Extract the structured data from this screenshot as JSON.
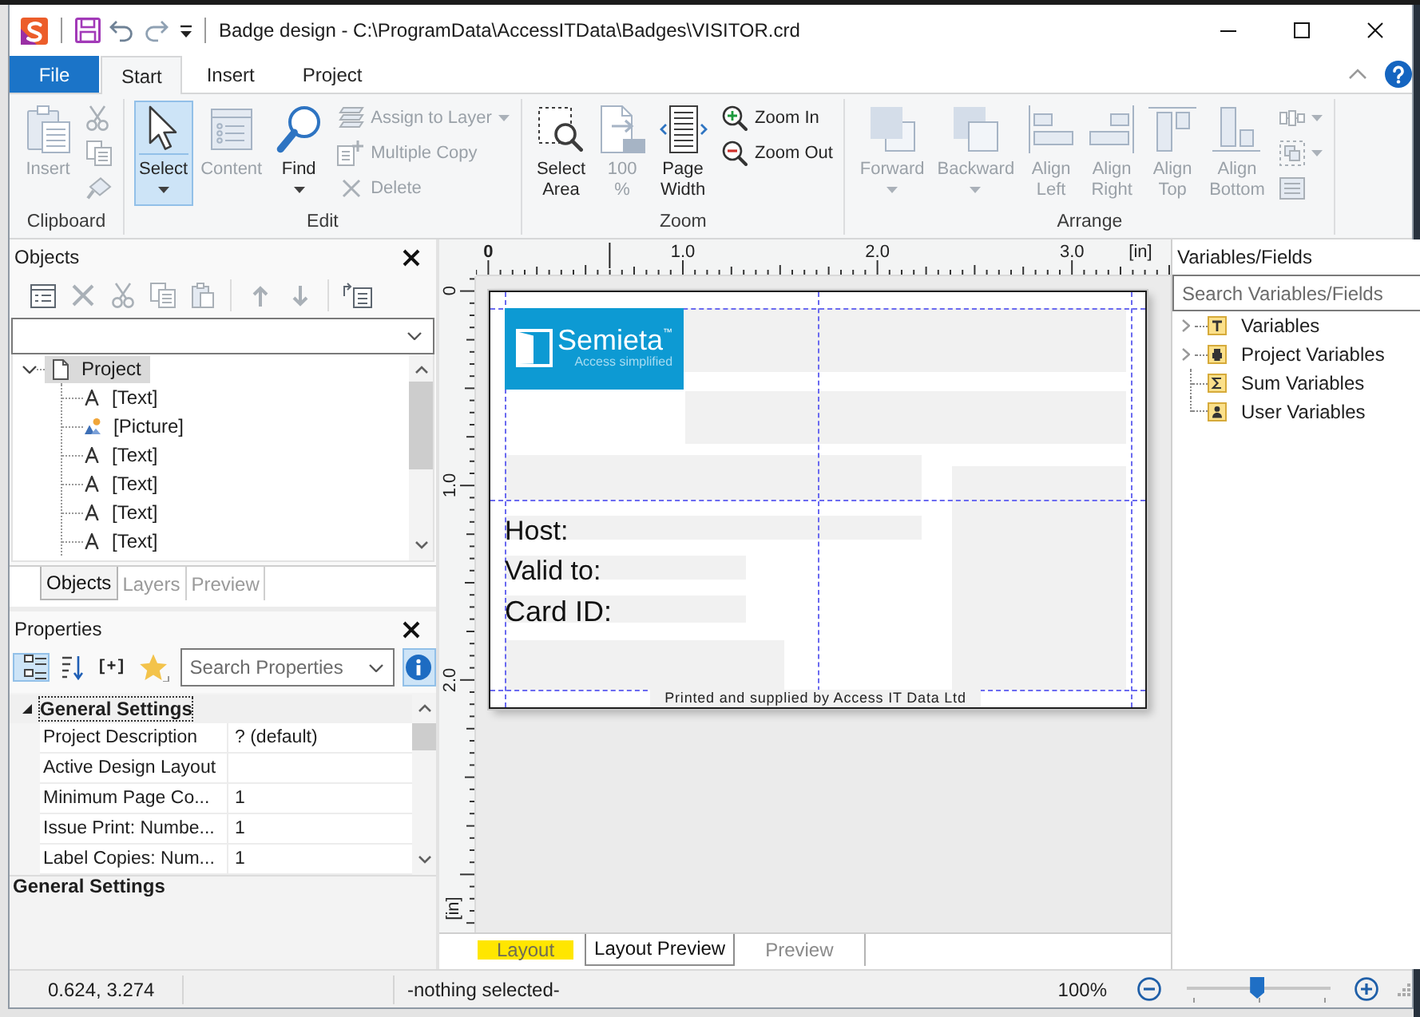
{
  "window": {
    "title": "Badge design - C:\\ProgramData\\AccessITData\\Badges\\VISITOR.crd"
  },
  "ribbon": {
    "tabs": [
      {
        "label": "File",
        "kind": "file",
        "selected": false
      },
      {
        "label": "Start",
        "kind": "tab",
        "selected": true
      },
      {
        "label": "Insert",
        "kind": "tab",
        "selected": false
      },
      {
        "label": "Project",
        "kind": "tab",
        "selected": false
      }
    ],
    "groups": [
      {
        "label": "Clipboard",
        "large": [
          {
            "label": "Insert",
            "disabled": true,
            "pressed": false,
            "dropdown": false
          }
        ],
        "small": [
          {
            "disabled": true,
            "dropdown": false
          },
          {
            "disabled": true,
            "dropdown": false
          },
          {
            "disabled": true,
            "dropdown": false
          }
        ]
      },
      {
        "label": "Edit",
        "large": [
          {
            "label": "Select",
            "disabled": false,
            "pressed": true,
            "dropdown": true
          },
          {
            "label": "Content",
            "disabled": true,
            "pressed": false,
            "dropdown": false
          },
          {
            "label": "Find",
            "disabled": false,
            "pressed": false,
            "dropdown": true
          }
        ],
        "small": [
          {
            "label": "Assign to Layer",
            "disabled": true,
            "dropdown": true
          },
          {
            "label": "Multiple Copy",
            "disabled": true,
            "dropdown": false
          },
          {
            "label": "Delete",
            "disabled": true,
            "dropdown": false
          }
        ]
      },
      {
        "label": "Zoom",
        "large": [
          {
            "label": "Select Area",
            "disabled": false,
            "pressed": false,
            "dropdown": false
          },
          {
            "label": "100 %",
            "disabled": true,
            "pressed": false,
            "dropdown": false
          },
          {
            "label": "Page Width",
            "disabled": false,
            "pressed": false,
            "dropdown": false
          }
        ],
        "small": [
          {
            "label": "Zoom In",
            "disabled": false,
            "dropdown": false
          },
          {
            "label": "Zoom Out",
            "disabled": false,
            "dropdown": false
          }
        ]
      },
      {
        "label": "Arrange",
        "large": [
          {
            "label": "Forward",
            "disabled": true,
            "pressed": false,
            "dropdown": true
          },
          {
            "label": "Backward",
            "disabled": true,
            "pressed": false,
            "dropdown": true
          },
          {
            "label": "Align Left",
            "disabled": true,
            "pressed": false,
            "dropdown": false
          },
          {
            "label": "Align Right",
            "disabled": true,
            "pressed": false,
            "dropdown": false
          },
          {
            "label": "Align Top",
            "disabled": true,
            "pressed": false,
            "dropdown": false
          },
          {
            "label": "Align Bottom",
            "disabled": true,
            "pressed": false,
            "dropdown": false
          }
        ],
        "small": [
          {
            "disabled": true,
            "dropdown": true
          },
          {
            "disabled": true,
            "dropdown": true
          },
          {
            "disabled": true,
            "dropdown": false
          }
        ]
      }
    ]
  },
  "objects_panel": {
    "title": "Objects",
    "tools": [
      {
        "disabled": false
      },
      {
        "disabled": true
      },
      {
        "disabled": true
      },
      {
        "disabled": true
      },
      {
        "disabled": true
      },
      {
        "disabled": true
      },
      {
        "disabled": true
      },
      {
        "disabled": false
      }
    ],
    "tree": {
      "label": "Project",
      "expanded": true,
      "selected": true,
      "children": [
        {
          "label": "[Text]",
          "kind": "text",
          "selected": false
        },
        {
          "label": "[Picture]",
          "kind": "picture",
          "selected": false
        },
        {
          "label": "[Text]",
          "kind": "text",
          "selected": false
        },
        {
          "label": "[Text]",
          "kind": "text",
          "selected": false
        },
        {
          "label": "[Text]",
          "kind": "text",
          "selected": false
        },
        {
          "label": "[Text]",
          "kind": "text",
          "selected": false
        }
      ]
    },
    "tabs": [
      {
        "label": "Objects",
        "selected": true
      },
      {
        "label": "Layers",
        "selected": false
      },
      {
        "label": "Preview",
        "selected": false
      }
    ]
  },
  "properties_panel": {
    "title": "Properties",
    "tools": [
      {
        "kind": "categorized",
        "pressed": true
      },
      {
        "kind": "sort",
        "pressed": false
      },
      {
        "kind": "text",
        "label": "[+]",
        "pressed": false
      },
      {
        "kind": "favorites",
        "pressed": false
      }
    ],
    "search": {
      "placeholder": "Search Properties"
    },
    "info": {
      "pressed": true
    },
    "category": {
      "label": "General Settings",
      "expanded": true
    },
    "rows": [
      {
        "name": "Project Description",
        "value": "? (default)"
      },
      {
        "name": "Active Design Layout"
      },
      {
        "name": "Minimum Page Co...",
        "value": "1"
      },
      {
        "name": "Issue Print: Numbe...",
        "value": "1"
      },
      {
        "name": "Label Copies: Num...",
        "value": "1"
      }
    ],
    "description": "General Settings"
  },
  "canvas": {
    "ruler": {
      "top_labels": [
        "0",
        "1.0",
        "2.0",
        "3.0"
      ],
      "top_unit": "[in]",
      "side_labels": [
        "0",
        "1.0",
        "2.0"
      ],
      "side_unit": "[in]"
    },
    "badge": {
      "logo": {
        "wordmark": "Semieta$^{™}$",
        "tagline": "Access simplified"
      },
      "labels": [
        "Host:",
        "Valid to:",
        "Card ID:"
      ],
      "footer": "Printed and supplied by Access IT Data Ltd"
    },
    "tabs": [
      {
        "label": "Layout",
        "selected": false,
        "highlighted": true
      },
      {
        "label": "Layout Preview",
        "selected": true,
        "highlighted": false
      },
      {
        "label": "Preview",
        "selected": false,
        "highlighted": false
      }
    ]
  },
  "fields_panel": {
    "title": "Variables/Fields",
    "search": {
      "placeholder": "Search Variables/Fields"
    },
    "items": [
      {
        "label": "Variables",
        "expandable": true
      },
      {
        "label": "Project Variables",
        "expandable": true
      },
      {
        "label": "Sum Variables",
        "expandable": false
      },
      {
        "label": "User Variables",
        "expandable": false
      }
    ]
  },
  "status_bar": {
    "position": "0.624, 3.274",
    "selection": "-nothing selected-",
    "zoom": {
      "label": "100%",
      "level": 0.49
    }
  }
}
